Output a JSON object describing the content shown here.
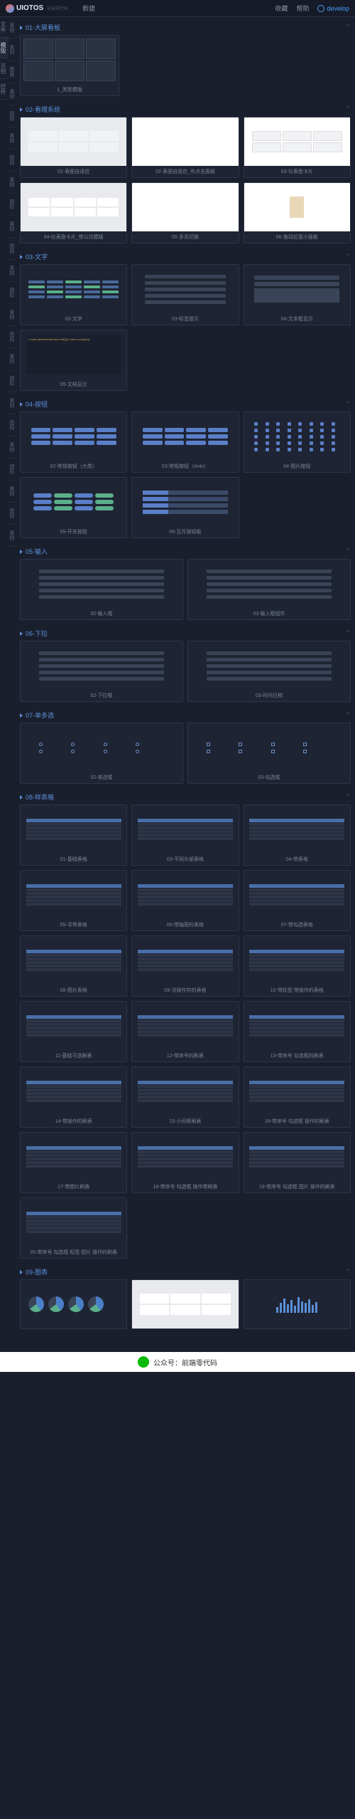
{
  "header": {
    "logo": "UIOTOS",
    "logo_sub": "前端零代码",
    "new_btn": "新建",
    "fav": "收藏",
    "help": "帮助",
    "user": "develop"
  },
  "side_tabs": [
    "文件",
    "模版",
    "示例",
    "控件"
  ],
  "mat_tabs": [
    "素材",
    "素材",
    "模版",
    "素材",
    "图标",
    "素材",
    "图标",
    "素材",
    "图标",
    "素材",
    "图标",
    "素材",
    "图标",
    "素材",
    "图标",
    "素材",
    "图标",
    "素材",
    "图标",
    "素材",
    "图标",
    "素材",
    "图标",
    "素材"
  ],
  "sections": [
    {
      "id": "s01",
      "title": "01-大屏看板",
      "items": [
        {
          "label": "1_类型模版",
          "type": "dash"
        }
      ]
    },
    {
      "id": "s02",
      "title": "02-看理系统",
      "items": [
        {
          "label": "01-表面自适应",
          "type": "light-grid"
        },
        {
          "label": "02-表面自适应_布点击面板",
          "type": "white-blank"
        },
        {
          "label": "03-仪表盘卡片",
          "type": "white-grid"
        },
        {
          "label": "04-仪表盘卡片_带公共模版",
          "type": "light-cards"
        },
        {
          "label": "05-多页切换",
          "type": "white-blank"
        },
        {
          "label": "06-拖动拉宽小面板",
          "type": "white-item"
        }
      ]
    },
    {
      "id": "s03",
      "title": "03-文字",
      "items": [
        {
          "label": "02-文字",
          "type": "txtgrid"
        },
        {
          "label": "03-标签提示",
          "type": "inps"
        },
        {
          "label": "04-文本框显示",
          "type": "blocks"
        },
        {
          "label": "05-文档显示",
          "type": "code"
        }
      ]
    },
    {
      "id": "s04",
      "title": "04-按钮",
      "items": [
        {
          "label": "02-常规按钮（大类）",
          "type": "btns"
        },
        {
          "label": "03-常规按钮（Antv）",
          "type": "btns2"
        },
        {
          "label": "04-图片按钮",
          "type": "icns"
        },
        {
          "label": "05-开关按钮",
          "type": "switches"
        },
        {
          "label": "06-互斥按钮板",
          "type": "tabs"
        }
      ]
    },
    {
      "id": "s05",
      "title": "05-输入",
      "items": [
        {
          "label": "02-输入框",
          "type": "inps"
        },
        {
          "label": "03-输入框组件",
          "type": "inps"
        }
      ]
    },
    {
      "id": "s06",
      "title": "06-下拉",
      "items": [
        {
          "label": "02-下拉框",
          "type": "inps"
        },
        {
          "label": "03-时间日期",
          "type": "inps"
        }
      ]
    },
    {
      "id": "s07",
      "title": "07-单多选",
      "items": [
        {
          "label": "02-单选框",
          "type": "radios"
        },
        {
          "label": "03-勾选框",
          "type": "checks"
        }
      ]
    },
    {
      "id": "s08",
      "title": "08-样表格",
      "items": [
        {
          "label": "01-基础表格",
          "type": "tbl"
        },
        {
          "label": "03-不同头部表格",
          "type": "tbl"
        },
        {
          "label": "04-带表格",
          "type": "tbl"
        },
        {
          "label": "05-寻常表格",
          "type": "tbl"
        },
        {
          "label": "06-带抽屉的表格",
          "type": "tbl"
        },
        {
          "label": "07-带勾选表格",
          "type": "tbl"
        },
        {
          "label": "08-图片表格",
          "type": "tbl"
        },
        {
          "label": "09-寻操作符的表格",
          "type": "tbl"
        },
        {
          "label": "10-带标签 带操作的表格",
          "type": "tbl"
        },
        {
          "label": "11-基础可选刷表",
          "type": "tbl"
        },
        {
          "label": "12-带序号的刷表",
          "type": "tbl"
        },
        {
          "label": "13-带序号 勾选框的刷表",
          "type": "tbl"
        },
        {
          "label": "14-带操作的刷表",
          "type": "tbl"
        },
        {
          "label": "15-小间距刷表",
          "type": "tbl"
        },
        {
          "label": "16-带序号 勾选框 操作的刷表",
          "type": "tbl"
        },
        {
          "label": "17-带图片刷表",
          "type": "tbl"
        },
        {
          "label": "18-带序号 勾选框 操作带刷表",
          "type": "tbl"
        },
        {
          "label": "19-带序号 勾选框 图片 操作的刷表",
          "type": "tbl"
        },
        {
          "label": "20-带序号 勾选框 标签 图片 操作的刷表",
          "type": "tbl"
        }
      ]
    },
    {
      "id": "s09",
      "title": "09-图表",
      "items": [
        {
          "label": "",
          "type": "pies"
        },
        {
          "label": "",
          "type": "cards-chart"
        },
        {
          "label": "",
          "type": "bars"
        }
      ]
    }
  ],
  "footer": {
    "prefix": "公众号：",
    "name": "前端零代码"
  }
}
